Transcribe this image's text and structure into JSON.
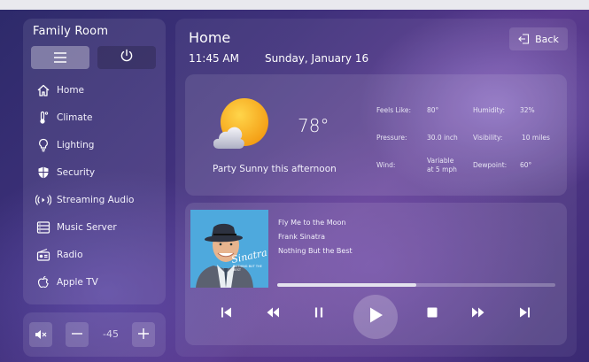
{
  "room": {
    "title": "Family Room"
  },
  "sidebar": {
    "items": [
      {
        "label": "Home",
        "icon": "home-icon"
      },
      {
        "label": "Climate",
        "icon": "thermometer-icon"
      },
      {
        "label": "Lighting",
        "icon": "lightbulb-icon"
      },
      {
        "label": "Security",
        "icon": "shield-icon"
      },
      {
        "label": "Streaming Audio",
        "icon": "broadcast-icon"
      },
      {
        "label": "Music Server",
        "icon": "server-icon"
      },
      {
        "label": "Radio",
        "icon": "radio-icon"
      },
      {
        "label": "Apple TV",
        "icon": "apple-icon"
      }
    ]
  },
  "volume": {
    "value": "-45"
  },
  "header": {
    "title": "Home",
    "time": "11:45 AM",
    "date": "Sunday, January 16",
    "back_label": "Back"
  },
  "weather": {
    "temperature": "78°",
    "forecast": "Party Sunny this afternoon",
    "stats": [
      {
        "label": "Feels Like:",
        "value": "80°"
      },
      {
        "label": "Humidity:",
        "value": "32%"
      },
      {
        "label": "Pressure:",
        "value": "30.0 inch"
      },
      {
        "label": "Visibility:",
        "value": "10 miles"
      },
      {
        "label": "Wind:",
        "value_line1": "Variable",
        "value_line2": "at 5 mph"
      },
      {
        "label": "Dewpoint:",
        "value": "60°"
      }
    ]
  },
  "music": {
    "track": "Fly Me to the Moon",
    "artist": "Frank Sinatra",
    "album": "Nothing But the Best",
    "album_art_text": "Sinatra",
    "album_art_subtext": "NOTHING BUT THE BEST",
    "progress": 0.5
  },
  "colors": {
    "accent_sun": "#f5a623",
    "panel": "rgba(255,255,255,0.09)"
  }
}
